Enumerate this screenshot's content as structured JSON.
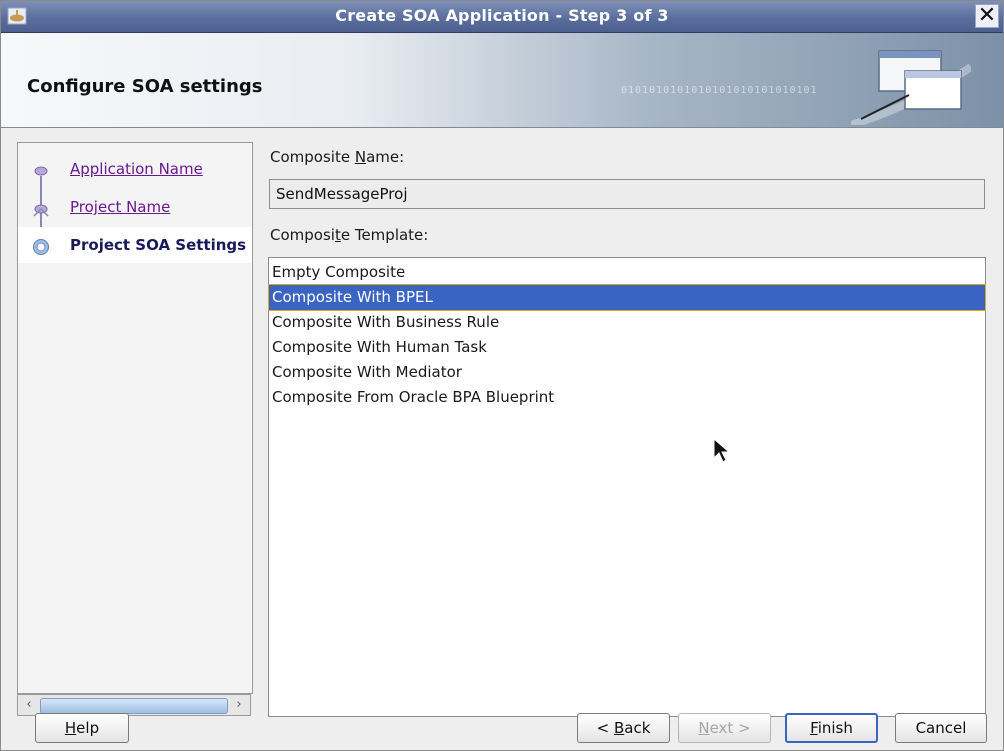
{
  "window": {
    "title": "Create SOA Application - Step 3 of 3",
    "close_glyph": "✕"
  },
  "banner": {
    "title": "Configure SOA settings",
    "binary_text": "0101010101010101010101010101",
    "icon": "window-pages-icon"
  },
  "nav": {
    "items": [
      {
        "label": "Application Name",
        "state": "visited"
      },
      {
        "label": "Project Name",
        "state": "visited"
      },
      {
        "label": "Project SOA Settings",
        "state": "current"
      }
    ]
  },
  "form": {
    "composite_name_label_pre": "Composite ",
    "composite_name_label_mnemonic": "N",
    "composite_name_label_post": "ame:",
    "composite_name_value": "SendMessageProj",
    "composite_template_label_pre": "Composi",
    "composite_template_label_mnemonic": "t",
    "composite_template_label_post": "e Template:",
    "templates": [
      "Empty Composite",
      "Composite With BPEL",
      "Composite With Business Rule",
      "Composite With Human Task",
      "Composite With Mediator",
      "Composite From Oracle BPA Blueprint"
    ],
    "selected_template": "Composite With BPEL"
  },
  "buttons": {
    "help": {
      "mnemonic": "H",
      "rest": "elp"
    },
    "back": {
      "pre": "< ",
      "mnemonic": "B",
      "rest": "ack"
    },
    "next": {
      "mnemonic": "N",
      "rest": "ext >"
    },
    "finish": {
      "mnemonic": "F",
      "rest": "inish"
    },
    "cancel": {
      "label": "Cancel"
    }
  },
  "colors": {
    "selection": "#3a64c4",
    "link": "#6a1a8f",
    "titlebar": "#5b6f9e"
  }
}
